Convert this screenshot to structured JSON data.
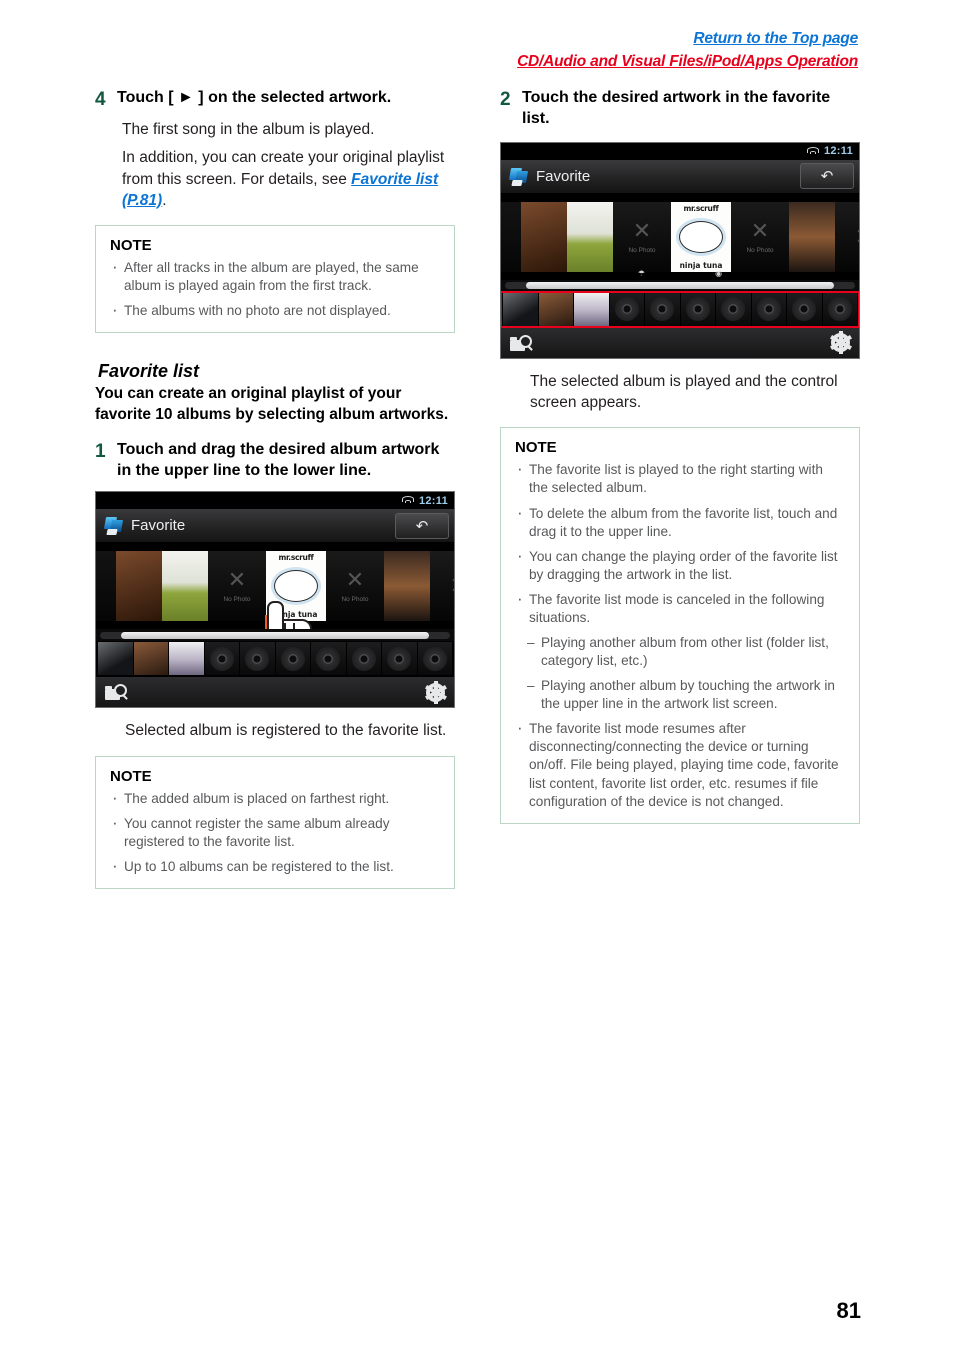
{
  "header": {
    "top_link": "Return to the Top page",
    "section_link": "CD/Audio and Visual Files/iPod/Apps Operation"
  },
  "page_number": "81",
  "left_column": {
    "step4": {
      "number": "4",
      "title": "Touch [ ► ] on the selected artwork.",
      "body1": "The first song in the album is played.",
      "body2_prefix": "In addition, you can create your original playlist from this screen. For details, see ",
      "body2_link": "Favorite list (P.81)",
      "body2_suffix": "."
    },
    "note1": {
      "title": "NOTE",
      "items": [
        "After all tracks in the album are played, the same album is played again from the first track.",
        "The albums with no photo are not displayed."
      ]
    },
    "section": {
      "heading": "Favorite list",
      "lede": "You can create an original playlist of your favorite 10 albums by selecting album artworks."
    },
    "step1": {
      "number": "1",
      "title": "Touch and drag the desired album artwork in the upper line to the lower line.",
      "result": "Selected album is registered to the favorite list."
    },
    "note2": {
      "title": "NOTE",
      "items": [
        "The added album is placed on farthest right.",
        "You cannot register the same album already registered to the favorite list.",
        "Up to 10 albums can be registered to the list."
      ]
    }
  },
  "right_column": {
    "step2": {
      "number": "2",
      "title": "Touch the desired artwork in the favorite list.",
      "result": "The selected album is played and the control screen appears."
    },
    "note3": {
      "title": "NOTE",
      "items": [
        {
          "type": "bullet",
          "text": "The favorite list is played to the right starting with the selected album."
        },
        {
          "type": "bullet",
          "text": "To delete the album from the favorite list, touch and drag it to the upper line."
        },
        {
          "type": "bullet",
          "text": "You can change the playing order of the favorite list by dragging the artwork in the list."
        },
        {
          "type": "bullet",
          "text": "The favorite list mode is canceled in the following situations."
        },
        {
          "type": "dash",
          "text": "Playing another album from other list (folder list, category list, etc.)"
        },
        {
          "type": "dash",
          "text": "Playing another album by touching the artwork in the upper line in the artwork list screen."
        },
        {
          "type": "bullet",
          "text": "The favorite list mode resumes after disconnecting/connecting the device or turning on/off. File being played, playing time code, favorite list content, favorite list order, etc. resumes if file configuration of the device is not changed."
        }
      ]
    }
  },
  "device_screen": {
    "status_clock": "12:11",
    "status_wifi_icon": "wifi-icon",
    "title": "Favorite",
    "title_icon": "favorite-app-icon",
    "back_icon": "back-arrow-icon",
    "artwork_nophoto_label": "No Photo",
    "artwork_nophoto_mark": "✕",
    "scruff_top": "mr.scruff",
    "scruff_bottom": "ninja tuna",
    "bottom_left_icon": "folder-search-icon",
    "bottom_right_icon": "gear-icon",
    "favorite_slots_total": 10,
    "favorite_slots_filled": 3,
    "highlight_color": "#e8001c",
    "drag_arrow_color": "#f15a22"
  }
}
